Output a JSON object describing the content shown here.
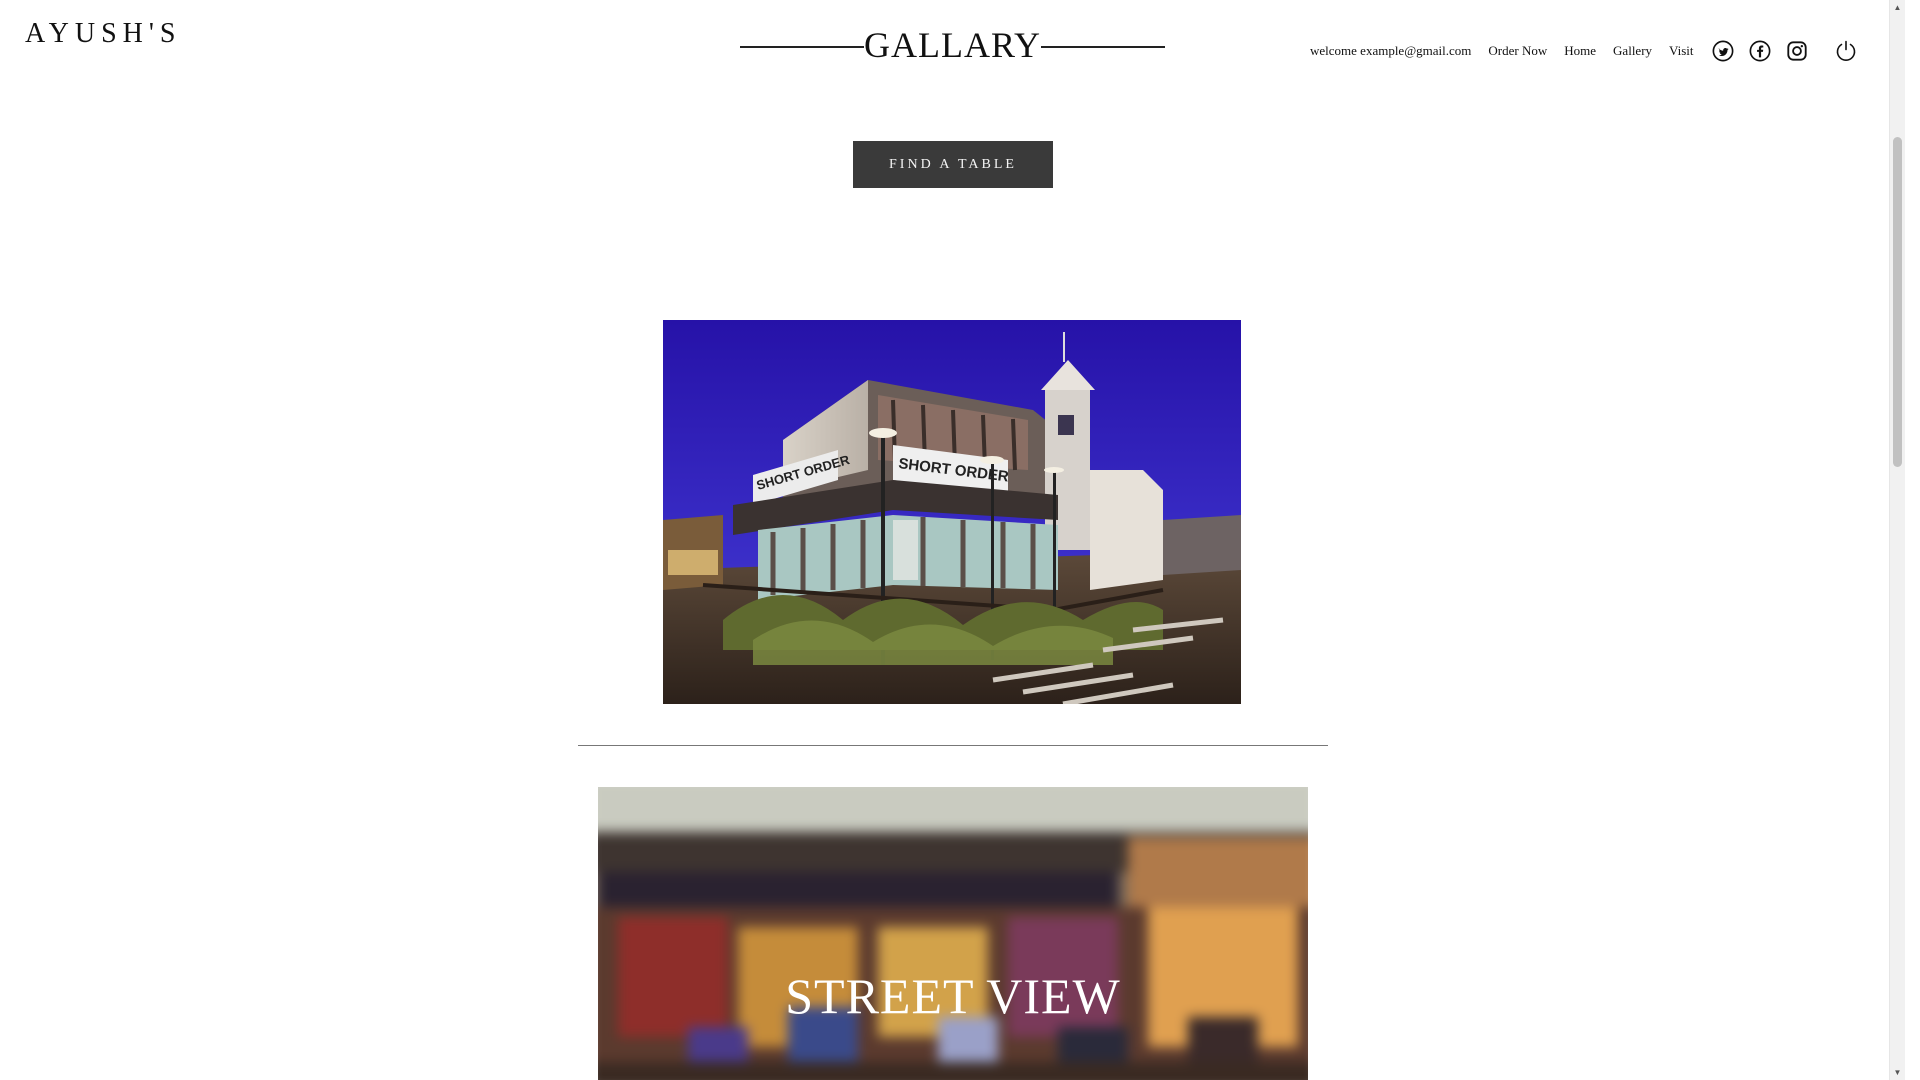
{
  "brand": {
    "name": "AYUSH'S"
  },
  "header": {
    "title": "GALLARY"
  },
  "nav": {
    "welcome": "welcome example@gmail.com",
    "links": [
      "Order Now",
      "Home",
      "Gallery",
      "Visit"
    ],
    "icons": [
      "twitter-icon",
      "facebook-icon",
      "instagram-icon",
      "power-icon"
    ]
  },
  "cta": {
    "find_table": "FIND A TABLE"
  },
  "gallery": {
    "street_caption": "STREET VIEW"
  },
  "colors": {
    "button_bg": "#3a3a3a",
    "night_sky": "#2d1fb5"
  }
}
